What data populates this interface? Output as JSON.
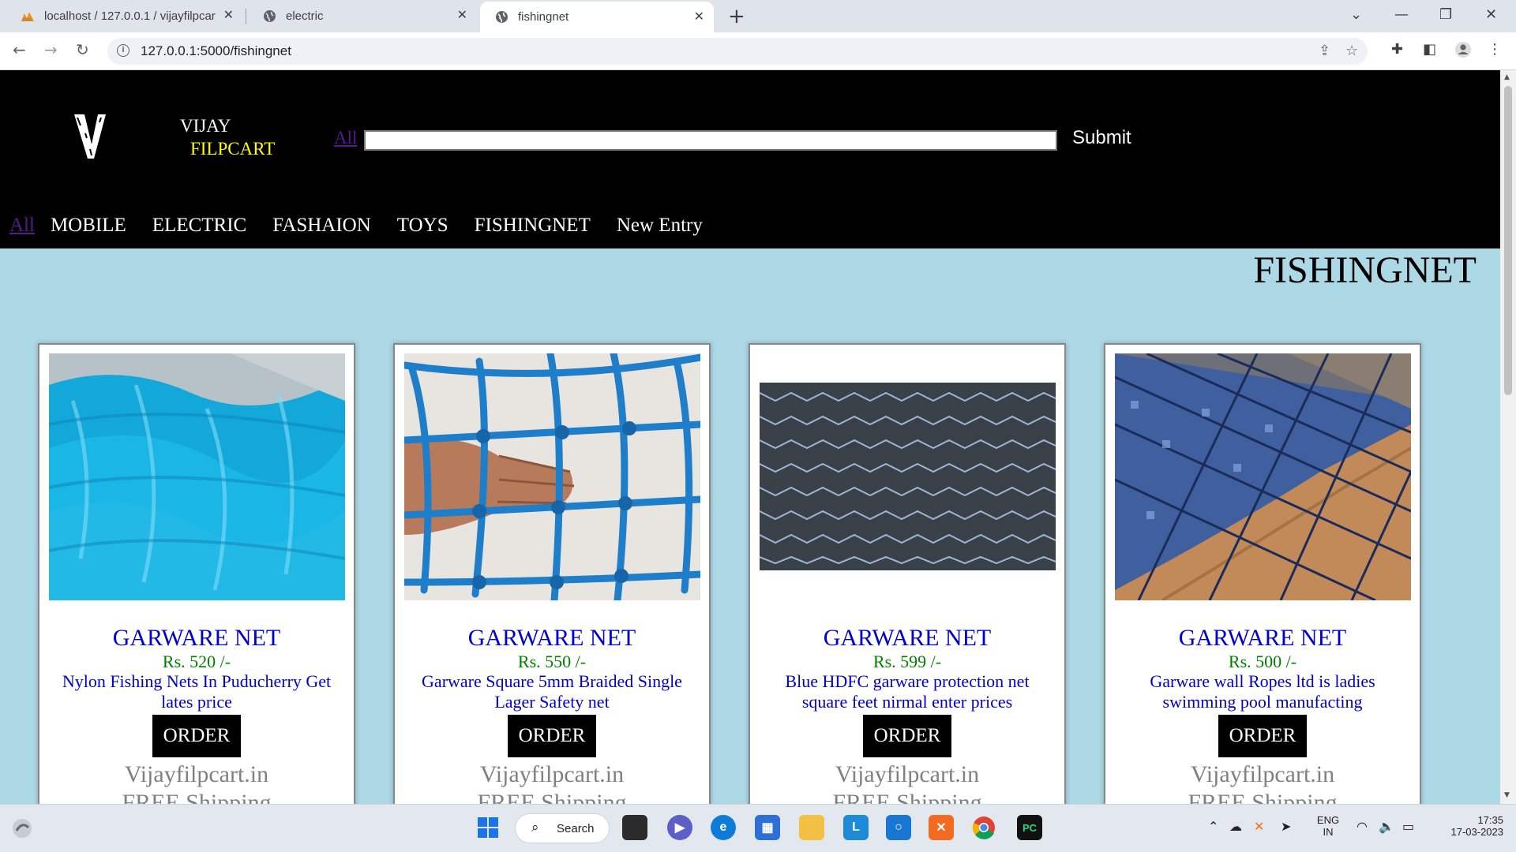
{
  "browser": {
    "tabs": [
      {
        "title": "localhost / 127.0.0.1 / vijayfilpcar",
        "icon": "phpmyadmin-icon"
      },
      {
        "title": "electric",
        "icon": "globe-icon"
      },
      {
        "title": "fishingnet",
        "icon": "globe-icon",
        "active": true
      }
    ],
    "url": "127.0.0.1:5000/fishingnet"
  },
  "site": {
    "brand_line1": "VIJAY",
    "brand_line2": "FILPCART",
    "search_all": "All",
    "search_value": "",
    "submit_label": "Submit",
    "nav": {
      "all": "All",
      "items": [
        "MOBILE",
        "ELECTRIC",
        "FASHAION",
        "TOYS",
        "FISHINGNET",
        "New Entry"
      ]
    },
    "page_heading": "FISHINGNET",
    "colors": {
      "page_bg": "#add8e6",
      "header_bg": "#000000",
      "brand_accent": "#ffff00",
      "product_name": "#0000cd",
      "price": "#008000"
    }
  },
  "products": [
    {
      "name": "GARWARE NET",
      "price": "Rs. 520 /-",
      "desc": "Nylon Fishing Nets In Puducherry Get lates price",
      "order": "ORDER",
      "site": "Vijayfilpcart.in",
      "shipping": "FREE Shipping"
    },
    {
      "name": "GARWARE NET",
      "price": "Rs. 550 /-",
      "desc": "Garware Square 5mm Braided Single Lager Safety net",
      "order": "ORDER",
      "site": "Vijayfilpcart.in",
      "shipping": "FREE Shipping"
    },
    {
      "name": "GARWARE NET",
      "price": "Rs. 599 /-",
      "desc": "Blue HDFC garware protection net square feet nirmal enter prices",
      "order": "ORDER",
      "site": "Vijayfilpcart.in",
      "shipping": "FREE Shipping"
    },
    {
      "name": "GARWARE NET",
      "price": "Rs. 500 /-",
      "desc": "Garware wall Ropes ltd is ladies swimming pool manufacting",
      "order": "ORDER",
      "site": "Vijayfilpcart.in",
      "shipping": "FREE Shipping"
    }
  ],
  "taskbar": {
    "search_label": "Search",
    "lang_line1": "ENG",
    "lang_line2": "IN",
    "time": "17:35",
    "date": "17-03-2023"
  }
}
